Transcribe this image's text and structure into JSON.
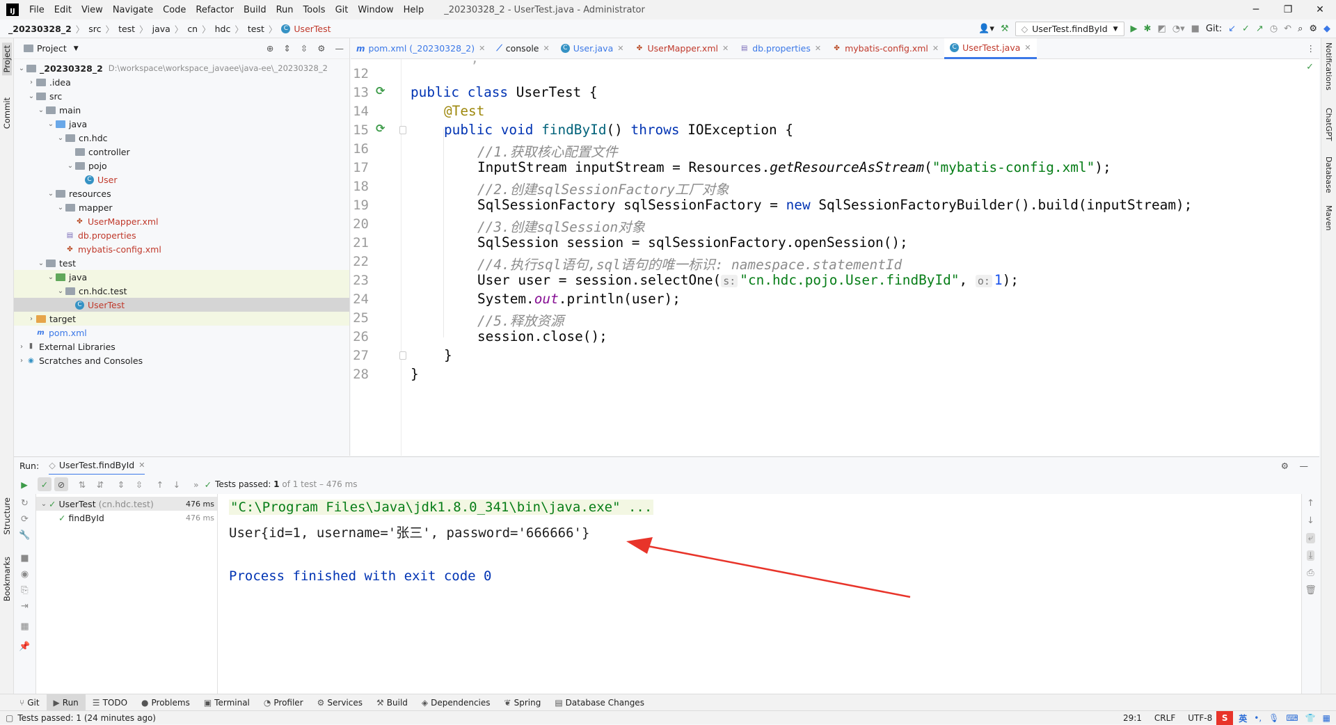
{
  "titlebar": {
    "menu": [
      "File",
      "Edit",
      "View",
      "Navigate",
      "Code",
      "Refactor",
      "Build",
      "Run",
      "Tools",
      "Git",
      "Window",
      "Help"
    ],
    "title": "_20230328_2 - UserTest.java - Administrator"
  },
  "breadcrumb": [
    "_20230328_2",
    "src",
    "test",
    "java",
    "cn",
    "hdc",
    "test",
    "UserTest"
  ],
  "toolbar": {
    "run_config": "UserTest.findById",
    "git_label": "Git:"
  },
  "left_strip": [
    "Project",
    "Commit",
    "Structure",
    "Bookmarks"
  ],
  "right_strip": [
    "Notifications",
    "ChatGPT",
    "Database",
    "Maven"
  ],
  "project": {
    "title": "Project",
    "root_name": "_20230328_2",
    "root_path": "D:\\workspace\\workspace_javaee\\java-ee\\_20230328_2",
    "nodes": [
      ".idea",
      "src",
      "main",
      "java",
      "cn.hdc",
      "controller",
      "pojo",
      "User",
      "resources",
      "mapper",
      "UserMapper.xml",
      "db.properties",
      "mybatis-config.xml",
      "test",
      "java",
      "cn.hdc.test",
      "UserTest",
      "target",
      "pom.xml",
      "External Libraries",
      "Scratches and Consoles"
    ]
  },
  "tabs": [
    {
      "label": "pom.xml (_20230328_2)"
    },
    {
      "label": "console"
    },
    {
      "label": "User.java"
    },
    {
      "label": "UserMapper.xml"
    },
    {
      "label": "db.properties"
    },
    {
      "label": "mybatis-config.xml"
    },
    {
      "label": "UserTest.java"
    }
  ],
  "editor": {
    "line_numbers": [
      "12",
      "13",
      "14",
      "15",
      "16",
      "17",
      "18",
      "19",
      "20",
      "21",
      "22",
      "23",
      "24",
      "25",
      "26",
      "27",
      "28"
    ],
    "c13a": "public class",
    "c13b": " UserTest {",
    "c14": "@Test",
    "c15a": "public void ",
    "c15b": "findById",
    "c15c": "() ",
    "c15d": "throws",
    "c15e": " IOException {",
    "c16": "//1.获取核心配置文件",
    "c17a": "InputStream inputStream = Resources.",
    "c17b": "getResourceAsStream",
    "c17c": "(",
    "c17d": "\"mybatis-config.xml\"",
    "c17e": ");",
    "c18": "//2.创建sqlSessionFactory工厂对象",
    "c19a": "SqlSessionFactory sqlSessionFactory = ",
    "c19b": "new",
    "c19c": " SqlSessionFactoryBuilder().build(inputStream);",
    "c20": "//3.创建sqlSession对象",
    "c21": "SqlSession session = sqlSessionFactory.openSession();",
    "c22": "//4.执行sql语句,sql语句的唯一标识: namespace.statementId",
    "c23a": "User user = session.selectOne(",
    "c23h1": "s:",
    "c23b": "\"cn.hdc.pojo.User.findById\"",
    "c23c": ", ",
    "c23h2": "o:",
    "c23d": "1",
    "c23e": ");",
    "c24a": "System.",
    "c24b": "out",
    "c24c": ".println(user);",
    "c25": "//5.释放资源",
    "c26": "session.close();",
    "c27": "}",
    "c28": "}"
  },
  "run": {
    "label": "Run:",
    "tab": "UserTest.findById",
    "status_a": "Tests passed: ",
    "status_b": "1",
    "status_c": " of 1 test – 476 ms",
    "tree": [
      {
        "name": "UserTest",
        "pkg": "(cn.hdc.test)",
        "time": "476 ms"
      },
      {
        "name": "findById",
        "time": "476 ms"
      }
    ],
    "console": [
      "\"C:\\Program Files\\Java\\jdk1.8.0_341\\bin\\java.exe\" ...",
      "User{id=1, username='张三', password='666666'}",
      "Process finished with exit code 0"
    ]
  },
  "tooltabs": [
    "Git",
    "Run",
    "TODO",
    "Problems",
    "Terminal",
    "Profiler",
    "Services",
    "Build",
    "Dependencies",
    "Spring",
    "Database Changes"
  ],
  "status": {
    "message": "Tests passed: 1 (24 minutes ago)",
    "position": "29:1",
    "line_sep": "CRLF",
    "encoding": "UTF-8",
    "ime": "英"
  }
}
